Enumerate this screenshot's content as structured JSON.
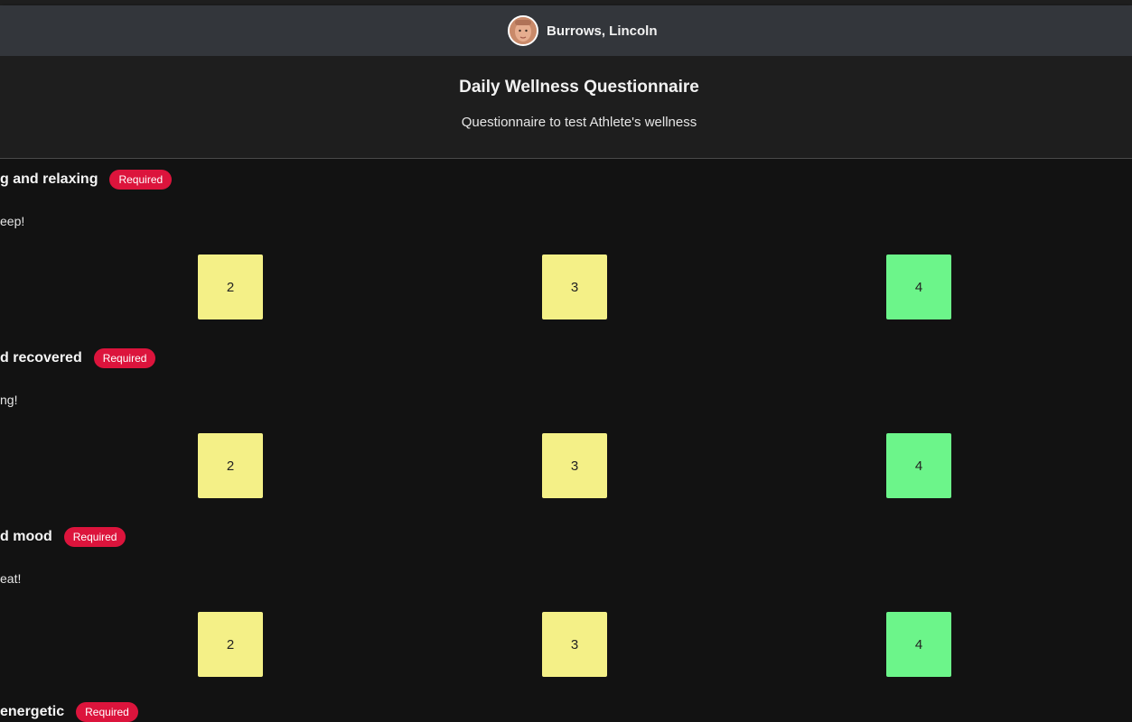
{
  "header": {
    "user_name": "Burrows, Lincoln"
  },
  "questionnaire": {
    "title": "Daily Wellness Questionnaire",
    "subtitle": "Questionnaire to test Athlete's wellness"
  },
  "colors": {
    "required_badge": "#dc143c",
    "option_yellow": "#f4f087",
    "option_green": "#6cf58a",
    "header_bg": "#33363b",
    "page_bg": "#121212"
  },
  "questions": [
    {
      "label": "g and relaxing",
      "badge": "Required",
      "description": "eep!",
      "options": [
        "2",
        "3",
        "4"
      ]
    },
    {
      "label": "d recovered",
      "badge": "Required",
      "description": "ng!",
      "options": [
        "2",
        "3",
        "4"
      ]
    },
    {
      "label": "d mood",
      "badge": "Required",
      "description": "eat!",
      "options": [
        "2",
        "3",
        "4"
      ]
    },
    {
      "label": "energetic",
      "badge": "Required"
    }
  ]
}
